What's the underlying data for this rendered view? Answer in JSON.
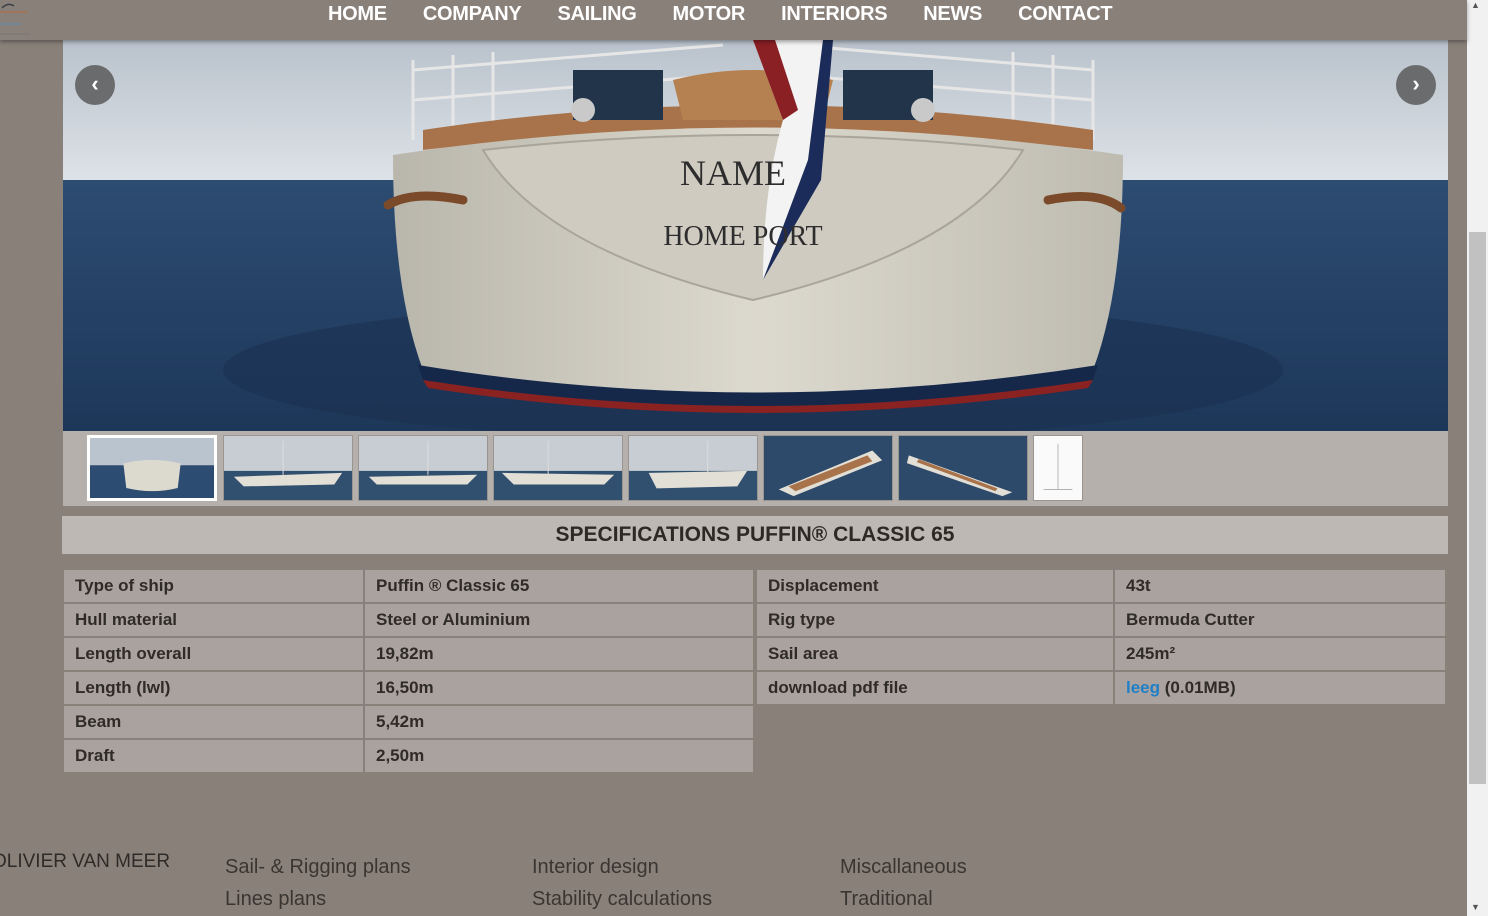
{
  "nav": {
    "items": [
      "HOME",
      "COMPANY",
      "SAILING",
      "MOTOR",
      "INTERIORS",
      "NEWS",
      "CONTACT"
    ]
  },
  "hero": {
    "transom_name": "NAME",
    "transom_port": "HOME PORT",
    "prev_icon": "chevron-left-icon",
    "next_icon": "chevron-right-icon"
  },
  "specs": {
    "title": "SPECIFICATIONS PUFFIN® CLASSIC 65",
    "left": [
      {
        "label": "Type of ship",
        "value": "Puffin ® Classic 65"
      },
      {
        "label": "Hull material",
        "value": "Steel or Aluminium"
      },
      {
        "label": "Length overall",
        "value": "19,82m"
      },
      {
        "label": "Length (lwl)",
        "value": "16,50m"
      },
      {
        "label": "Beam",
        "value": "5,42m"
      },
      {
        "label": "Draft",
        "value": "2,50m"
      }
    ],
    "right": [
      {
        "label": "Displacement",
        "value": "43t"
      },
      {
        "label": "Rig type",
        "value": "Bermuda Cutter"
      },
      {
        "label": "Sail area",
        "value": "245m²"
      },
      {
        "label": "download pdf file",
        "link": "leeg",
        "suffix": " (0.01MB)"
      }
    ]
  },
  "footer": {
    "brand": "OLIVIER VAN MEER",
    "col1": [
      "Sail- & Rigging plans",
      "Lines plans"
    ],
    "col2": [
      "Interior design",
      "Stability calculations"
    ],
    "col3": [
      "Miscallaneous",
      "Traditional"
    ]
  },
  "colors": {
    "background": "#8a807a",
    "link": "#1e7fc8",
    "cell": "#aaa29e"
  }
}
